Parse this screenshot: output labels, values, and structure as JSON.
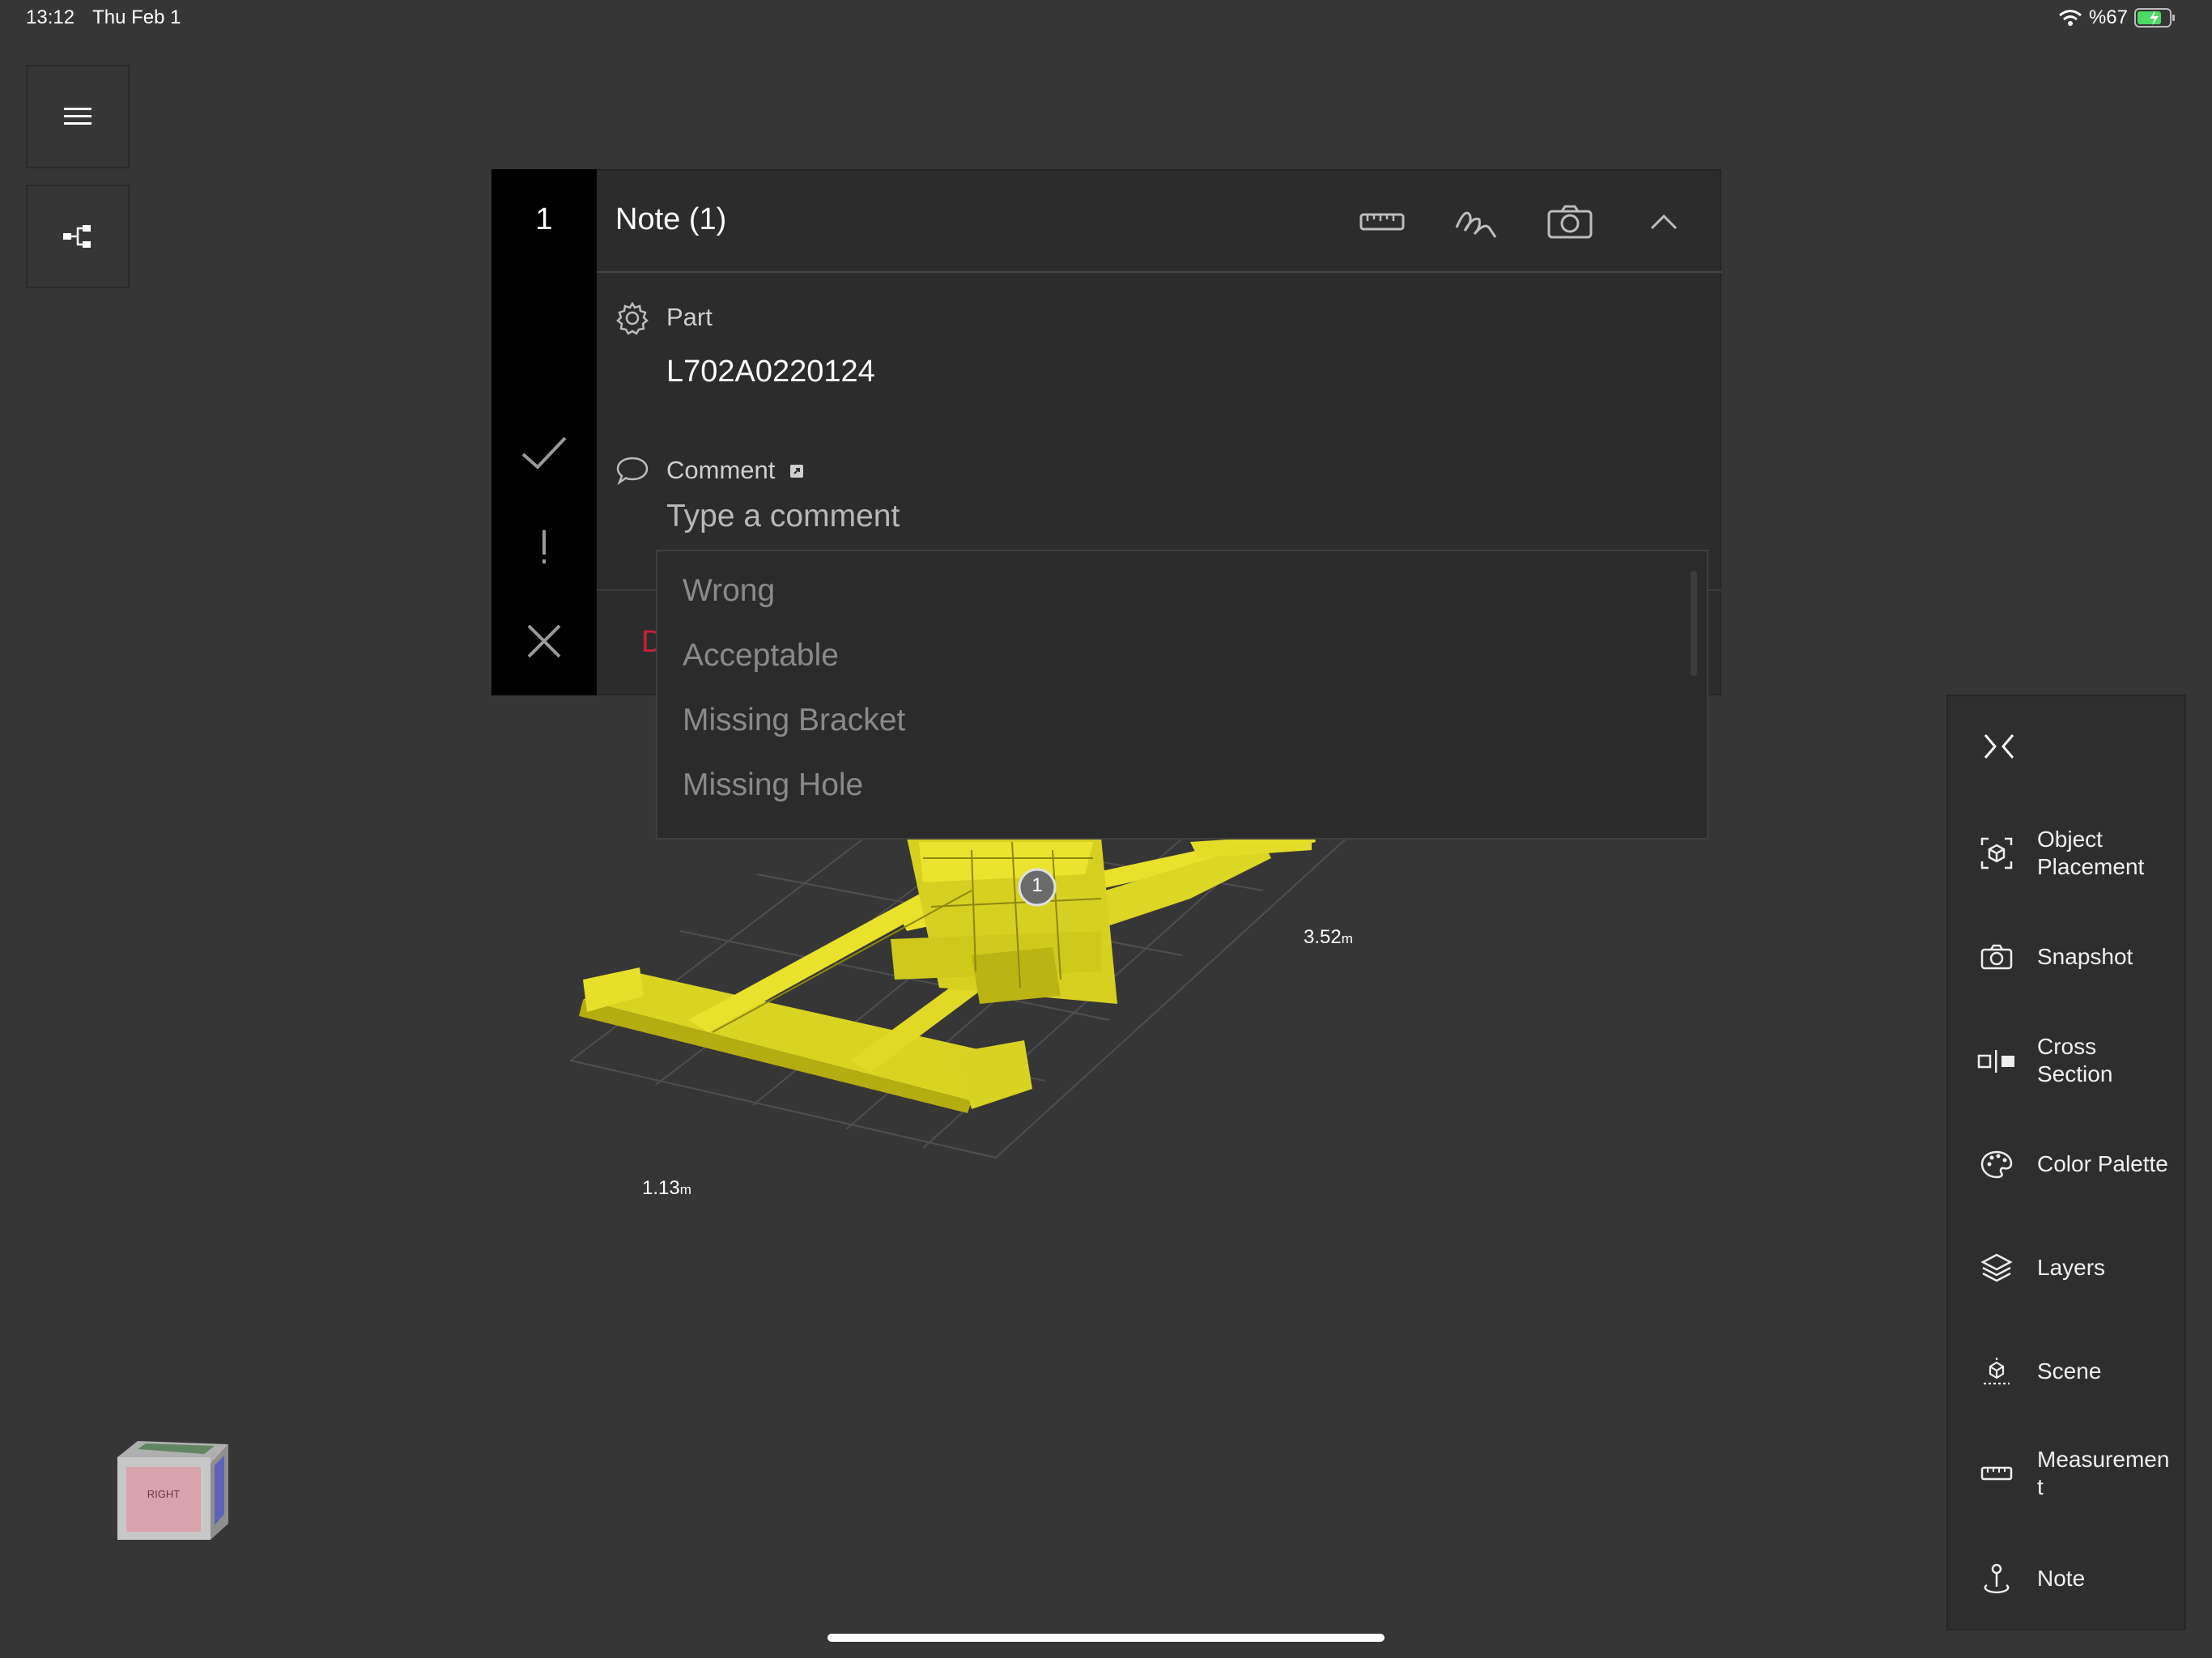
{
  "status_bar": {
    "time": "13:12",
    "date": "Thu Feb 1",
    "battery": "%67"
  },
  "note": {
    "number": "1",
    "title": "Note (1)",
    "part_label": "Part",
    "part_value": "L702A0220124",
    "comment_label": "Comment",
    "comment_placeholder": "Type a comment",
    "delete_peek": "D"
  },
  "comment_suggestions": [
    "Wrong",
    "Acceptable",
    "Missing Bracket",
    "Missing Hole"
  ],
  "toolbar": {
    "items": [
      {
        "label": "Object\nPlacement",
        "icon": "object-placement-icon"
      },
      {
        "label": "Snapshot",
        "icon": "camera-icon"
      },
      {
        "label": "Cross\nSection",
        "icon": "cross-section-icon"
      },
      {
        "label": "Color Palette",
        "icon": "palette-icon"
      },
      {
        "label": "Layers",
        "icon": "layers-icon"
      },
      {
        "label": "Scene",
        "icon": "scene-icon"
      },
      {
        "label": "Measuremen\nt",
        "icon": "ruler-icon"
      },
      {
        "label": "Note",
        "icon": "pin-icon"
      }
    ]
  },
  "viewport": {
    "dimension_depth": "3.52",
    "dimension_width": "1.13",
    "unit": "m",
    "marker_label": "1",
    "view_cube_face": "RIGHT"
  },
  "colors": {
    "model": "#e6e02a",
    "delete": "#c4223a",
    "accent_battery": "#4cd964"
  }
}
